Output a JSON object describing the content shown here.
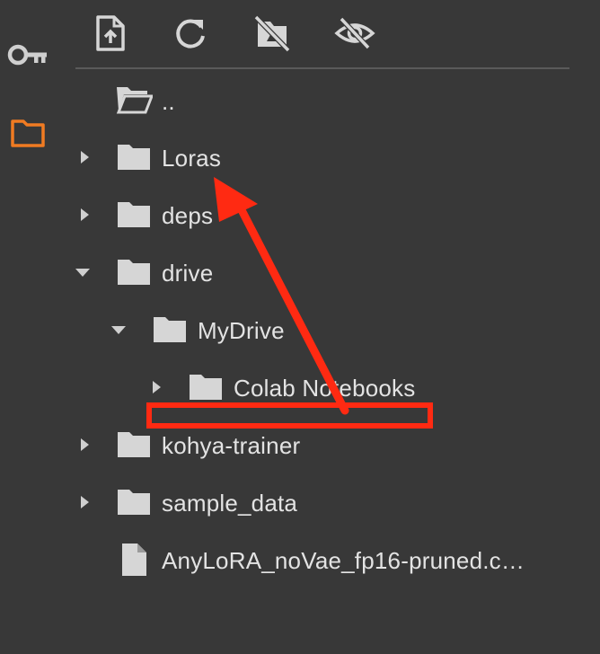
{
  "sidebar": {
    "icons": [
      "key-icon",
      "folder-icon"
    ],
    "active_color": "#f07b22"
  },
  "toolbar": {
    "buttons": [
      "upload-file-icon",
      "refresh-icon",
      "hide-drive-icon",
      "hide-hidden-files-icon"
    ]
  },
  "file_tree": {
    "items": [
      {
        "label": "..",
        "type": "parent"
      },
      {
        "label": "Loras",
        "type": "folder",
        "expanded": false
      },
      {
        "label": "deps",
        "type": "folder",
        "expanded": false
      },
      {
        "label": "drive",
        "type": "folder",
        "expanded": true
      },
      {
        "label": "MyDrive",
        "type": "folder",
        "expanded": true
      },
      {
        "label": "Colab Notebooks",
        "type": "folder",
        "expanded": false
      },
      {
        "label": "kohya-trainer",
        "type": "folder",
        "expanded": false
      },
      {
        "label": "sample_data",
        "type": "folder",
        "expanded": false
      },
      {
        "label": "AnyLoRA_noVae_fp16-pruned.c…",
        "type": "file"
      }
    ]
  },
  "annotation": {
    "color": "#ff2a12",
    "shapes": [
      "highlight-rectangle",
      "arrow"
    ]
  }
}
